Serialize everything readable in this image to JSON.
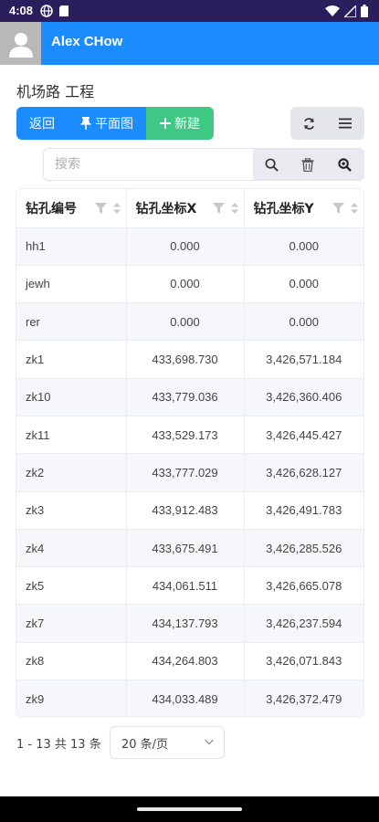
{
  "status_bar": {
    "time": "4:08"
  },
  "appbar": {
    "username": "Alex CHow"
  },
  "page": {
    "title": "机场路 工程"
  },
  "toolbar": {
    "back_label": "返回",
    "plan_label": "平面图",
    "new_label": "新建"
  },
  "search": {
    "placeholder": "搜索",
    "value": ""
  },
  "table": {
    "columns": [
      "钻孔编号",
      "钻孔坐标X",
      "钻孔坐标Y"
    ],
    "rows": [
      [
        "hh1",
        "0.000",
        "0.000"
      ],
      [
        "jewh",
        "0.000",
        "0.000"
      ],
      [
        "rer",
        "0.000",
        "0.000"
      ],
      [
        "zk1",
        "433,698.730",
        "3,426,571.184"
      ],
      [
        "zk10",
        "433,779.036",
        "3,426,360.406"
      ],
      [
        "zk11",
        "433,529.173",
        "3,426,445.427"
      ],
      [
        "zk2",
        "433,777.029",
        "3,426,628.127"
      ],
      [
        "zk3",
        "433,912.483",
        "3,426,491.783"
      ],
      [
        "zk4",
        "433,675.491",
        "3,426,285.526"
      ],
      [
        "zk5",
        "434,061.511",
        "3,426,665.078"
      ],
      [
        "zk7",
        "434,137.793",
        "3,426,237.594"
      ],
      [
        "zk8",
        "434,264.803",
        "3,426,071.843"
      ],
      [
        "zk9",
        "434,033.489",
        "3,426,372.479"
      ]
    ]
  },
  "pagination": {
    "summary": "1 - 13 共 13 条",
    "page_size": "20 条/页"
  },
  "colors": {
    "primary": "#1a8cff",
    "success": "#3ec883",
    "status_bar": "#2a1f5c"
  }
}
